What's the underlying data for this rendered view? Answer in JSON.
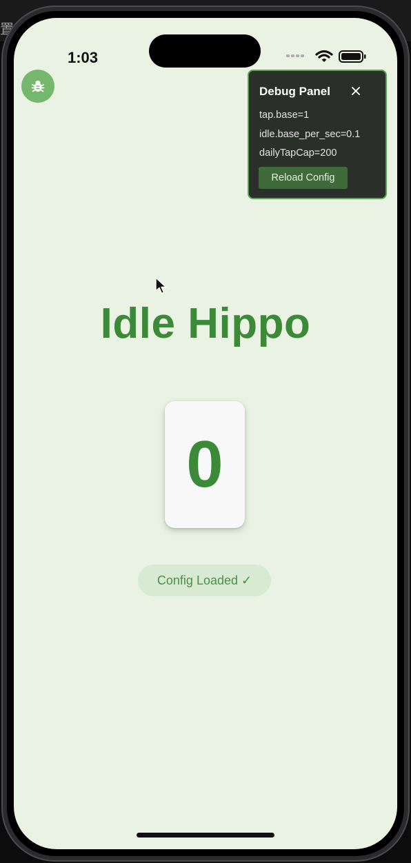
{
  "status_bar": {
    "time": "1:03"
  },
  "debug_panel": {
    "title": "Debug Panel",
    "lines": [
      "tap.base=1",
      "idle.base_per_sec=0.1",
      "dailyTapCap=200"
    ],
    "reload_label": "Reload Config"
  },
  "main": {
    "title": "Idle Hippo",
    "counter": "0",
    "status_chip": "Config Loaded ✓"
  },
  "icons": {
    "debug_button": "bug-icon",
    "close": "close-icon",
    "wifi": "wifi-icon",
    "battery": "battery-icon",
    "signal": "signal-icon"
  },
  "colors": {
    "screen_background": "#eaf3e3",
    "accent_green": "#3c8a38",
    "debug_fab": "#74b86e",
    "panel_background": "#2b2f2a",
    "panel_border": "#57a451",
    "reload_button": "#3e6b39",
    "chip_background": "#d8ebd2"
  }
}
